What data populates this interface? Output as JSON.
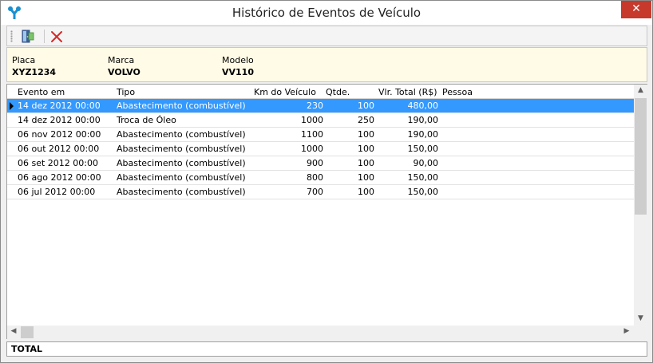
{
  "window": {
    "title": "Histórico de Eventos de Veículo",
    "close_label": "✕"
  },
  "toolbar": {
    "buttons": [
      {
        "name": "exit-door-icon"
      },
      {
        "name": "delete-x-icon"
      }
    ]
  },
  "vehicle": {
    "plate_label": "Placa",
    "plate_value": "XYZ1234",
    "brand_label": "Marca",
    "brand_value": "VOLVO",
    "model_label": "Modelo",
    "model_value": "VV110"
  },
  "grid": {
    "columns": [
      "Evento em",
      "Tipo",
      "Km do Veículo",
      "Qtde.",
      "Vlr. Total (R$)",
      "Pessoa"
    ],
    "rows": [
      {
        "evento": "14 dez 2012 00:00",
        "tipo": "Abastecimento (combustível)",
        "km": "230",
        "qtde": "100",
        "total": "480,00",
        "pessoa": "",
        "selected": true
      },
      {
        "evento": "14 dez 2012 00:00",
        "tipo": "Troca de Óleo",
        "km": "1000",
        "qtde": "250",
        "total": "190,00",
        "pessoa": ""
      },
      {
        "evento": "06 nov 2012 00:00",
        "tipo": "Abastecimento (combustível)",
        "km": "1100",
        "qtde": "100",
        "total": "190,00",
        "pessoa": ""
      },
      {
        "evento": "06 out 2012 00:00",
        "tipo": "Abastecimento (combustível)",
        "km": "1000",
        "qtde": "100",
        "total": "150,00",
        "pessoa": ""
      },
      {
        "evento": "06 set 2012 00:00",
        "tipo": "Abastecimento (combustível)",
        "km": "900",
        "qtde": "100",
        "total": "90,00",
        "pessoa": ""
      },
      {
        "evento": "06 ago 2012 00:00",
        "tipo": "Abastecimento (combustível)",
        "km": "800",
        "qtde": "100",
        "total": "150,00",
        "pessoa": ""
      },
      {
        "evento": "06 jul 2012 00:00",
        "tipo": "Abastecimento (combustível)",
        "km": "700",
        "qtde": "100",
        "total": "150,00",
        "pessoa": ""
      }
    ]
  },
  "footer": {
    "total_label": "TOTAL"
  },
  "colors": {
    "selection": "#3399ff",
    "info_background": "#fffbe6",
    "close_button": "#c7392b"
  }
}
